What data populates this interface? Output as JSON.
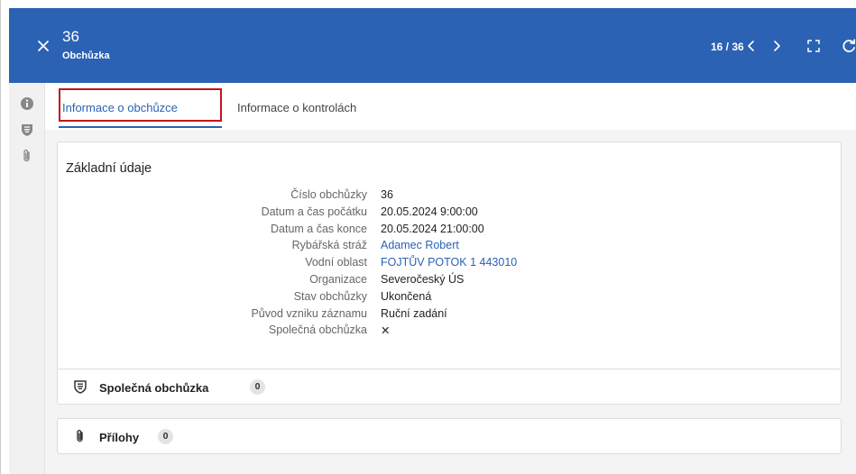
{
  "header": {
    "title": "36",
    "subtitle": "Obchůzka",
    "pager": "16 / 36",
    "color": "#2b62b4"
  },
  "icons": {
    "close": "close-icon",
    "prev": "chevron-left-icon",
    "next": "chevron-right-icon",
    "fullscreen": "fullscreen-icon",
    "refresh": "refresh-icon",
    "rail": [
      "info-icon",
      "shield-icon",
      "paperclip-icon"
    ]
  },
  "tabs": [
    {
      "label": "Informace o obchůzce",
      "active": true
    },
    {
      "label": "Informace o kontrolách",
      "active": false
    }
  ],
  "basic_info": {
    "title": "Základní údaje",
    "rows": [
      {
        "label": "Číslo obchůzky",
        "value": "36",
        "link": false
      },
      {
        "label": "Datum a čas počátku",
        "value": "20.05.2024 9:00:00",
        "link": false
      },
      {
        "label": "Datum a čas konce",
        "value": "20.05.2024 21:00:00",
        "link": false
      },
      {
        "label": "Rybářská stráž",
        "value": "Adamec Robert",
        "link": true
      },
      {
        "label": "Vodní oblast",
        "value": "FOJTŮV POTOK 1 443010",
        "link": true
      },
      {
        "label": "Organizace",
        "value": "Severočeský ÚS",
        "link": false
      },
      {
        "label": "Stav obchůzky",
        "value": "Ukončená",
        "link": false
      },
      {
        "label": "Původ vzniku záznamu",
        "value": "Ruční zadání",
        "link": false
      },
      {
        "label": "Společná obchůzka",
        "value": "✕",
        "link": false
      }
    ]
  },
  "sections": [
    {
      "label": "Společná obchůzka",
      "count": "0",
      "icon": "shield-icon"
    },
    {
      "label": "Přílohy",
      "count": "0",
      "icon": "paperclip-icon"
    }
  ],
  "colors": {
    "accent": "#2b62b4",
    "highlight": "#c0151b"
  }
}
